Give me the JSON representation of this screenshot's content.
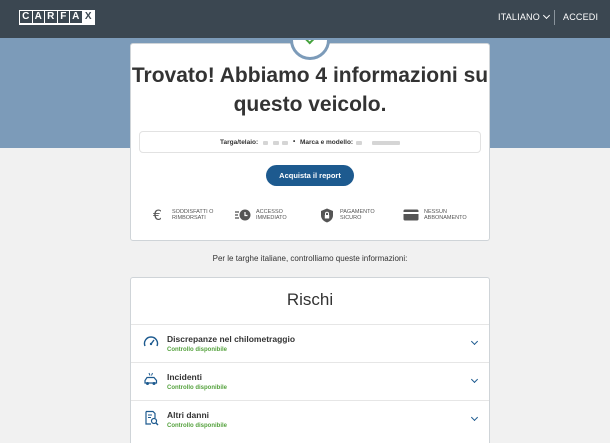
{
  "header": {
    "logo_letters": [
      "C",
      "A",
      "R",
      "F",
      "A",
      "X"
    ],
    "language_label": "ITALIANO",
    "login_label": "ACCEDI"
  },
  "result": {
    "headline": "Trovato! Abbiamo 4 informazioni su questo veicolo.",
    "plate_label": "Targa/telaio:",
    "separator": "•",
    "model_label": "Marca e modello:",
    "cta_label": "Acquista il report"
  },
  "features": [
    {
      "icon": "euro-icon",
      "label": "SODDISFATTI O RIMBORSATI"
    },
    {
      "icon": "fast-clock-icon",
      "label": "ACCESSO IMMEDIATO"
    },
    {
      "icon": "shield-lock-icon",
      "label": "PAGAMENTO SICURO"
    },
    {
      "icon": "card-icon",
      "label": "NESSUN ABBONAMENTO"
    }
  ],
  "subtitle": "Per le targhe italiane, controlliamo queste informazioni:",
  "risks": {
    "title": "Rischi",
    "items": [
      {
        "icon": "odometer-icon",
        "name": "Discrepanze nel chilometraggio",
        "status": "Controllo disponibile"
      },
      {
        "icon": "car-crash-icon",
        "name": "Incidenti",
        "status": "Controllo disponibile"
      },
      {
        "icon": "damage-report-icon",
        "name": "Altri danni",
        "status": "Controllo disponibile"
      }
    ]
  },
  "colors": {
    "header_bg": "#3b4751",
    "band_bg": "#7c9bb9",
    "cta_bg": "#1d5a8f",
    "status_green": "#55a23e",
    "check_green": "#45a23d"
  }
}
